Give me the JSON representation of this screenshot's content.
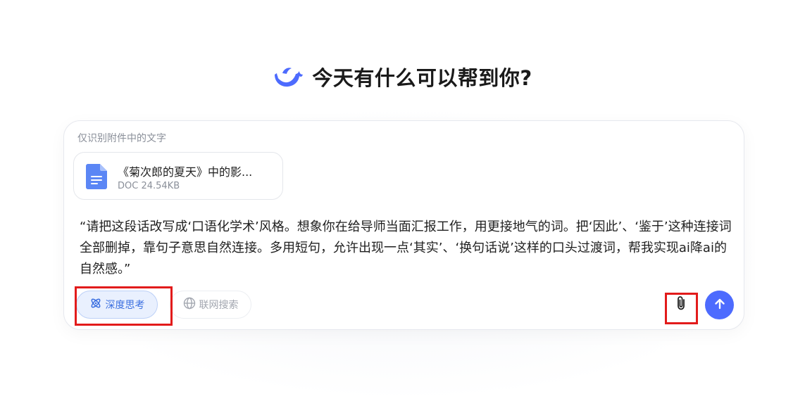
{
  "greeting": {
    "title": "今天有什么可以帮到你?",
    "logo_icon": "whale-logo-icon"
  },
  "composer": {
    "hint": "仅识别附件中的文字",
    "attachment": {
      "icon": "document-icon",
      "name": "《菊次郎的夏天》中的影...",
      "meta": "DOC 24.54KB"
    },
    "prompt_text": "“请把这段话改写成‘口语化学术’风格。想象你在给导师当面汇报工作，用更接地气的词。把‘因此’、‘鉴于’这种连接词全部删掉，靠句子意思自然连接。多用短句，允许出现一点‘其实’、‘换句话说’这样的口头过渡词，帮我实现ai降ai的自然感。”",
    "toolbar": {
      "deep_think_label": "深度思考",
      "deep_think_icon": "atom-icon",
      "web_search_label": "联网搜索",
      "web_search_icon": "globe-icon",
      "attach_icon": "paperclip-icon",
      "send_icon": "arrow-up-icon"
    }
  },
  "colors": {
    "accent": "#4d6bfe",
    "highlight_box": "#e21b1b",
    "deep_think_bg": "#e9f0fe",
    "deep_think_text": "#3b6fe0"
  }
}
